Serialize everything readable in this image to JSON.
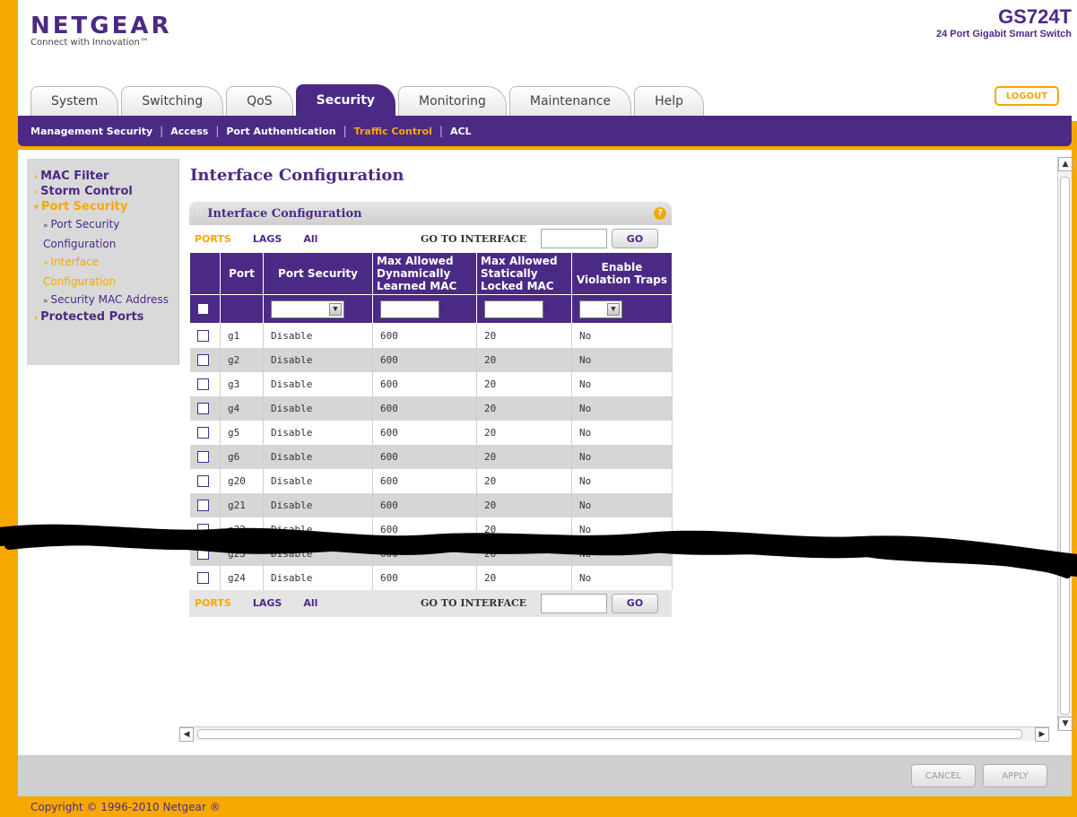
{
  "brand": {
    "logo": "NETGEAR",
    "tagline": "Connect with Innovation™"
  },
  "device": {
    "model": "GS724T",
    "description": "24 Port Gigabit Smart Switch"
  },
  "tabs": [
    {
      "label": "System"
    },
    {
      "label": "Switching"
    },
    {
      "label": "QoS"
    },
    {
      "label": "Security",
      "active": true
    },
    {
      "label": "Monitoring"
    },
    {
      "label": "Maintenance"
    },
    {
      "label": "Help"
    }
  ],
  "logout_label": "LOGOUT",
  "subnav": [
    {
      "label": "Management Security"
    },
    {
      "label": "Access"
    },
    {
      "label": "Port Authentication"
    },
    {
      "label": "Traffic Control",
      "active": true
    },
    {
      "label": "ACL"
    }
  ],
  "sidebar": {
    "mac_filter": "MAC Filter",
    "storm_control": "Storm Control",
    "port_security": "Port Security",
    "port_security_configuration": "Port Security Configuration",
    "interface_configuration": "Interface Configuration",
    "security_mac_address": "Security MAC Address",
    "protected_ports": "Protected Ports"
  },
  "page_title": "Interface Configuration",
  "panel": {
    "title": "Interface Configuration",
    "help_icon": "?",
    "filter": {
      "ports": "PORTS",
      "lags": "LAGS",
      "all": "All",
      "goto_label": "GO TO INTERFACE",
      "go_label": "GO"
    }
  },
  "table": {
    "headers": {
      "port": "Port",
      "port_security": "Port Security",
      "max_dynamic": "Max Allowed Dynamically Learned MAC",
      "max_static": "Max Allowed Statically Locked MAC",
      "enable_traps": "Enable Violation Traps"
    },
    "rows": [
      {
        "port": "g1",
        "security": "Disable",
        "max_dynamic": "600",
        "max_static": "20",
        "traps": "No"
      },
      {
        "port": "g2",
        "security": "Disable",
        "max_dynamic": "600",
        "max_static": "20",
        "traps": "No"
      },
      {
        "port": "g3",
        "security": "Disable",
        "max_dynamic": "600",
        "max_static": "20",
        "traps": "No"
      },
      {
        "port": "g4",
        "security": "Disable",
        "max_dynamic": "600",
        "max_static": "20",
        "traps": "No"
      },
      {
        "port": "g5",
        "security": "Disable",
        "max_dynamic": "600",
        "max_static": "20",
        "traps": "No"
      },
      {
        "port": "g6",
        "security": "Disable",
        "max_dynamic": "600",
        "max_static": "20",
        "traps": "No"
      },
      {
        "port": "g20",
        "security": "Disable",
        "max_dynamic": "600",
        "max_static": "20",
        "traps": "No"
      },
      {
        "port": "g21",
        "security": "Disable",
        "max_dynamic": "600",
        "max_static": "20",
        "traps": "No"
      },
      {
        "port": "g22",
        "security": "Disable",
        "max_dynamic": "600",
        "max_static": "20",
        "traps": "No"
      },
      {
        "port": "g23",
        "security": "Disable",
        "max_dynamic": "600",
        "max_static": "20",
        "traps": "No"
      },
      {
        "port": "g24",
        "security": "Disable",
        "max_dynamic": "600",
        "max_static": "20",
        "traps": "No"
      }
    ]
  },
  "footer": {
    "cancel": "CANCEL",
    "apply": "APPLY",
    "copyright": "Copyright © 1996-2010 Netgear ®"
  },
  "colors": {
    "brand_purple": "#4b2a86",
    "accent_orange": "#f7a800"
  },
  "icons": {
    "help": "help-icon",
    "dropdown": "chevron-down-icon",
    "scroll_up": "arrow-up-icon",
    "scroll_down": "arrow-down-icon"
  }
}
